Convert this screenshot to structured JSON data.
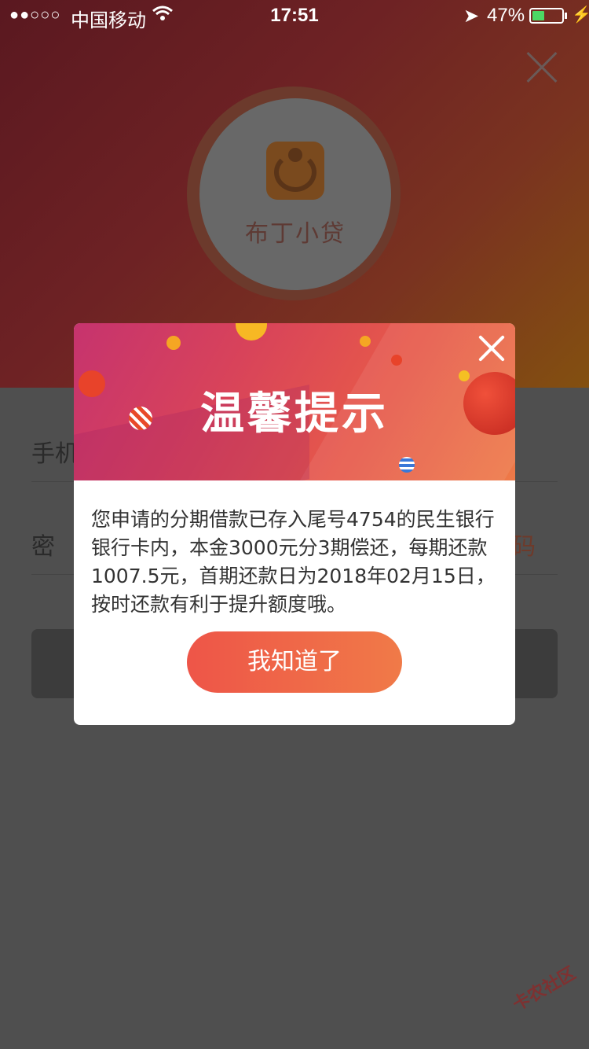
{
  "status_bar": {
    "signal": "●●○○○",
    "carrier": "中国移动",
    "time": "17:51",
    "battery_percent": "47%",
    "battery_level": 0.47
  },
  "background": {
    "app_name": "布丁小贷",
    "phone_label": "手机",
    "password_label": "密 码",
    "password_right_fragment": "码"
  },
  "modal": {
    "title": "温馨提示",
    "message": "您申请的分期借款已存入尾号4754的民生银行银行卡内，本金3000元分3期偿还，每期还款1007.5元，首期还款日为2018年02月15日，按时还款有利于提升额度哦。",
    "confirm_label": "我知道了"
  },
  "watermark": "卡农社区",
  "colors": {
    "accent": "#ee5548",
    "header_start": "#c6336e",
    "header_end": "#ee7a48",
    "battery": "#4cd964"
  }
}
